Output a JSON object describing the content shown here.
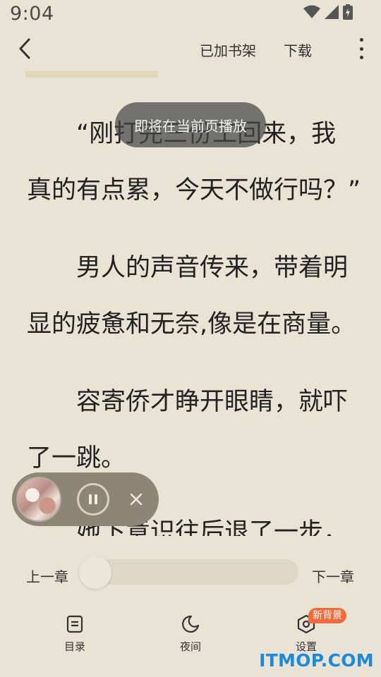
{
  "status": {
    "time": "9:04"
  },
  "topbar": {
    "added_to_shelf": "已加书架",
    "download": "下载"
  },
  "reading": {
    "lines": [
      "“刚打完三份工回来，我",
      "真的有点累，今天不做行吗？”",
      "男人的声音传来，带着明",
      "显的疲惫和无奈,像是在商量。",
      "容寄侨才睁开眼睛，就吓",
      "了一跳。",
      "她下意识往后退了一步，"
    ]
  },
  "toast": {
    "text": "即将在当前页播放"
  },
  "player": {
    "state": "playing"
  },
  "chapter_nav": {
    "prev": "上一章",
    "next": "下一章",
    "progress": 0.0
  },
  "bottom_nav": {
    "catalog": "目录",
    "night": "夜间",
    "settings": "设置",
    "settings_badge": "新背景"
  },
  "watermark": "ITMOP.COM",
  "colors": {
    "background": "#e8e3d4",
    "badge": "#f06a3c",
    "watermark": "#1d8ad9",
    "player": "#8d8676"
  }
}
